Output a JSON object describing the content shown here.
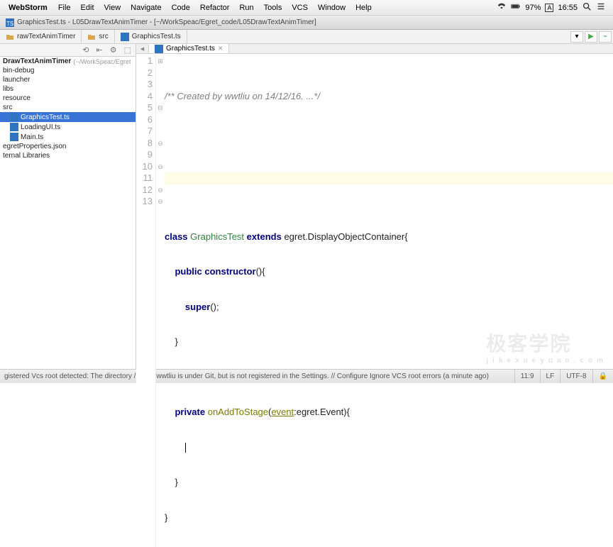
{
  "menubar": {
    "app": "WebStorm",
    "items": [
      "File",
      "Edit",
      "View",
      "Navigate",
      "Code",
      "Refactor",
      "Run",
      "Tools",
      "VCS",
      "Window",
      "Help"
    ],
    "battery": "97%",
    "clock": "16:55"
  },
  "titlebar": {
    "filename": "GraphicsTest.ts",
    "project": "L05DrawTextAnimTimer",
    "path": "[~/WorkSpeac/Egret_code/L05DrawTextAnimTimer]"
  },
  "breadcrumbs": {
    "items": [
      "rawTextAnimTimer",
      "src",
      "GraphicsTest.ts"
    ]
  },
  "sidebar": {
    "root": {
      "name": "DrawTextAnimTimer",
      "path": "(~/WorkSpeac/Egret"
    },
    "items": [
      "bin-debug",
      "launcher",
      "libs",
      "resource",
      "src"
    ],
    "srcChildren": [
      {
        "name": "GraphicsTest.ts",
        "selected": true
      },
      {
        "name": "LoadingUI.ts",
        "selected": false
      },
      {
        "name": "Main.ts",
        "selected": false
      }
    ],
    "rootFiles": [
      "egretProperties.json"
    ],
    "extLib": "ternal Libraries"
  },
  "tabs": {
    "active": "GraphicsTest.ts"
  },
  "code": {
    "lines": [
      {
        "n": 1,
        "t": "comment",
        "text": "/** Created by wwtliu on 14/12/16. ...*/"
      },
      {
        "n": 2,
        "t": "blank"
      },
      {
        "n": 3,
        "t": "blank"
      },
      {
        "n": 4,
        "t": "blank"
      },
      {
        "n": 5,
        "t": "classdecl"
      },
      {
        "n": 6,
        "t": "ctor"
      },
      {
        "n": 7,
        "t": "super"
      },
      {
        "n": 8,
        "t": "close2"
      },
      {
        "n": 9,
        "t": "blank"
      },
      {
        "n": 10,
        "t": "method"
      },
      {
        "n": 11,
        "t": "caret"
      },
      {
        "n": 12,
        "t": "close2"
      },
      {
        "n": 13,
        "t": "close1"
      }
    ],
    "tokens": {
      "class": "class",
      "className": "GraphicsTest",
      "extends": "extends",
      "baseClass": "egret.DisplayObjectContainer",
      "public": "public",
      "constructor": "constructor",
      "super": "super",
      "private": "private",
      "method": "onAddToStage",
      "param": "event",
      "paramType": "egret.Event"
    }
  },
  "status": {
    "msg": "gistered Vcs root detected: The directory /Users/wwtliu is under Git, but is not registered in the Settings. // Configure  Ignore VCS root errors (a minute ago)",
    "pos": "11:9",
    "le": "LF",
    "enc": "UTF-8"
  },
  "watermark": {
    "main": "极客学院",
    "sub": "jikexueyuan.com"
  }
}
